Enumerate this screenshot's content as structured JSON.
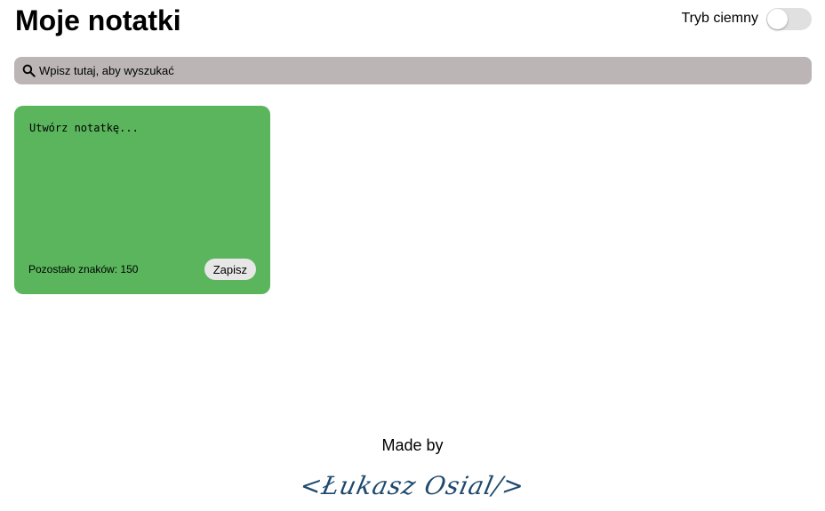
{
  "header": {
    "title": "Moje notatki",
    "dark_mode_label": "Tryb ciemny"
  },
  "search": {
    "placeholder": "Wpisz tutaj, aby wyszukać",
    "icon": "search-icon"
  },
  "new_note": {
    "placeholder": "Utwórz notatkę...",
    "remaining_label": "Pozostało znaków: 150",
    "save_label": "Zapisz",
    "background": "#5ab55d"
  },
  "footer": {
    "made_by": "Made by",
    "signature": "<Łukasz Osial/>"
  }
}
